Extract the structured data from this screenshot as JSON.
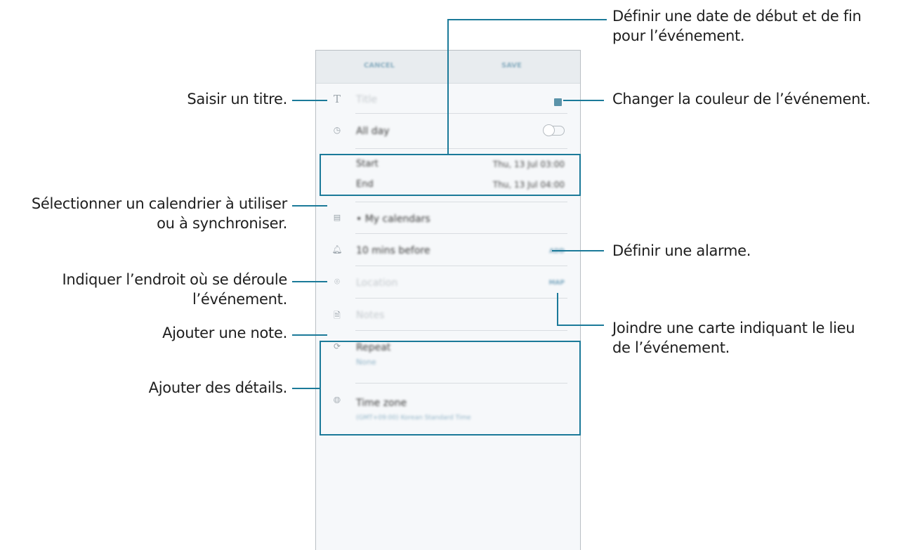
{
  "callouts": {
    "date_range": "Définir une date de début et de fin\npour l’événement.",
    "color": "Changer la couleur de l’événement.",
    "alarm": "Définir une alarme.",
    "map": "Joindre une carte indiquant le lieu\nde l’événement.",
    "title": "Saisir un titre.",
    "calendar": "Sélectionner un calendrier à utiliser\nou à synchroniser.",
    "location": "Indiquer l’endroit où se déroule\nl’événement.",
    "note": "Ajouter une note.",
    "details": "Ajouter des détails."
  },
  "header": {
    "cancel": "CANCEL",
    "save": "SAVE"
  },
  "form": {
    "title_placeholder": "Title",
    "all_day": "All day",
    "start_label": "Start",
    "start_value": "Thu, 13 Jul   03:00",
    "end_label": "End",
    "end_value": "Thu, 13 Jul   04:00",
    "calendar": "My calendars",
    "reminder": "10 mins before",
    "reminder_action": "ADD",
    "location_placeholder": "Location",
    "location_action": "MAP",
    "notes_placeholder": "Notes",
    "repeat_label": "Repeat",
    "repeat_value": "None",
    "timezone_label": "Time zone",
    "timezone_value": "(GMT+09:00) Korean Standard Time"
  },
  "colors": {
    "accent": "#1b7a99",
    "event_color": "#5b93a9"
  },
  "icons": [
    "title-icon",
    "clock-icon",
    "calendar-icon",
    "bell-icon",
    "location-pin-icon",
    "note-icon",
    "repeat-icon",
    "globe-icon"
  ]
}
